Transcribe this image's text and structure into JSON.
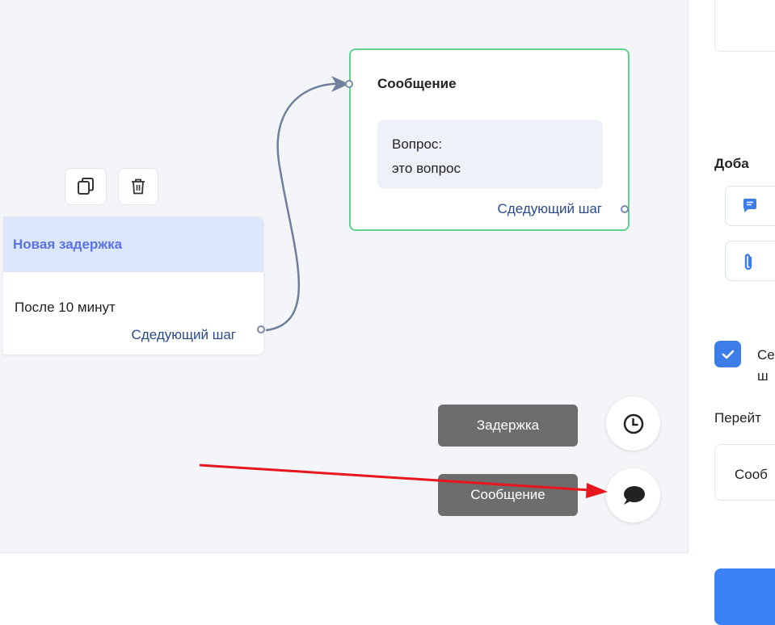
{
  "delay_node": {
    "title": "Новая задержка",
    "body": "После 10 минут",
    "next_step": "Сдедующий шаг",
    "tools": {
      "copy_icon": "copy-icon",
      "delete_icon": "trash-icon"
    }
  },
  "message_node": {
    "title": "Сообщение",
    "bubble_line1": "Вопрос:",
    "bubble_line2": "это вопрос",
    "next_step": "Сдедующий шаг"
  },
  "actions": {
    "delay_label": "Задержка",
    "message_label": "Сообщение",
    "delay_icon": "clock-icon",
    "message_icon": "chat-bubble-icon"
  },
  "right_panel": {
    "add_heading": "Доба",
    "checkbox_label_line1": "Се",
    "checkbox_label_line2": "ш",
    "goto_label": "Перейт",
    "select_value": "Сооб"
  },
  "colors": {
    "canvas_bg": "#f3f5f9",
    "delay_header_bg": "#dbe6fb",
    "delay_title": "#5a72e6",
    "message_border": "#5fd08f",
    "link": "#2b4a8a",
    "wire": "#6f809c",
    "annotation_arrow": "#e8161d",
    "primary": "#3b82f6"
  }
}
